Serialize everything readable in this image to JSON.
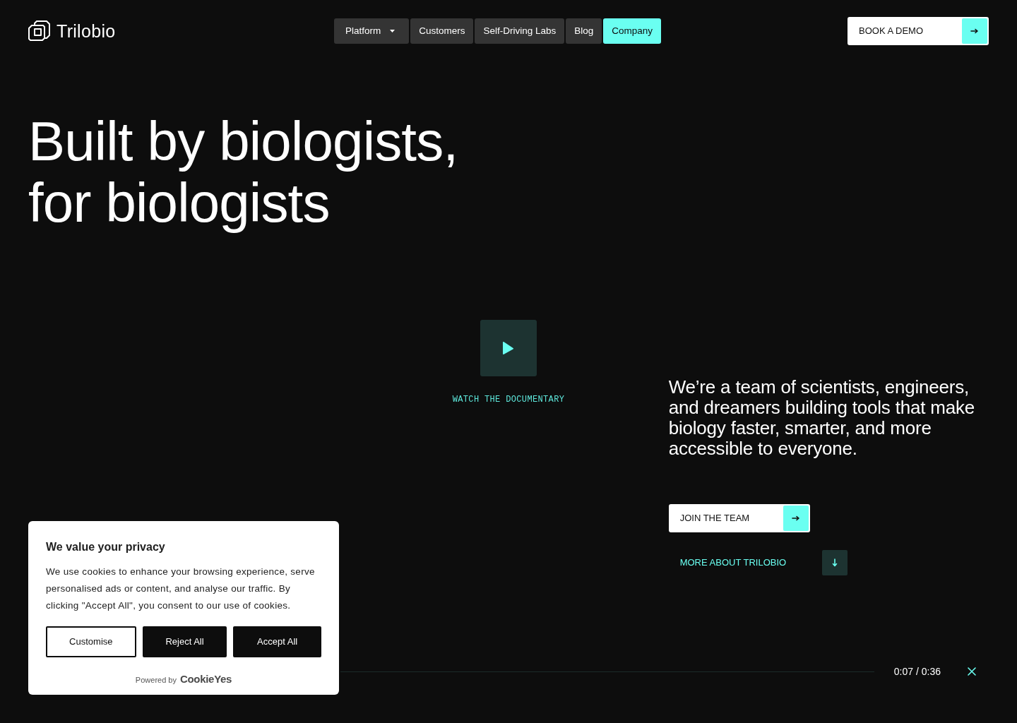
{
  "header": {
    "logo": {
      "text": "Trilobio"
    },
    "nav": [
      {
        "label": "Platform",
        "selected": false,
        "dropdown": true
      },
      {
        "label": "Customers",
        "selected": false,
        "dropdown": false
      },
      {
        "label": "Self-Driving Labs",
        "selected": false,
        "dropdown": false
      },
      {
        "label": "Blog",
        "selected": false,
        "dropdown": false
      },
      {
        "label": "Company",
        "selected": true,
        "dropdown": false
      }
    ],
    "cta": {
      "label": "BOOK A DEMO"
    }
  },
  "hero": {
    "title": "Built by biologists, for biologists"
  },
  "video": {
    "caption": "WATCH THE DOCUMENTARY",
    "time": "0:07 / 0:36"
  },
  "intro": {
    "text": "We’re a team of scientists, engineers, and dreamers building tools that make biology faster, smarter, and more accessible to everyone.",
    "primary_button": {
      "label": "JOIN THE TEAM"
    },
    "secondary_link": {
      "label": "MORE ABOUT TRILOBIO"
    }
  },
  "cookie_banner": {
    "title": "We value your privacy",
    "text": "We use cookies to enhance your browsing experience, serve personalised ads or content, and analyse our traffic. By clicking \"Accept All\", you consent to our use of cookies.",
    "buttons": [
      {
        "label": "Customise",
        "kind": "outline"
      },
      {
        "label": "Reject All",
        "kind": "solid"
      },
      {
        "label": "Accept All",
        "kind": "solid"
      }
    ],
    "powered_by": "Powered by",
    "provider": "CookieYes"
  }
}
